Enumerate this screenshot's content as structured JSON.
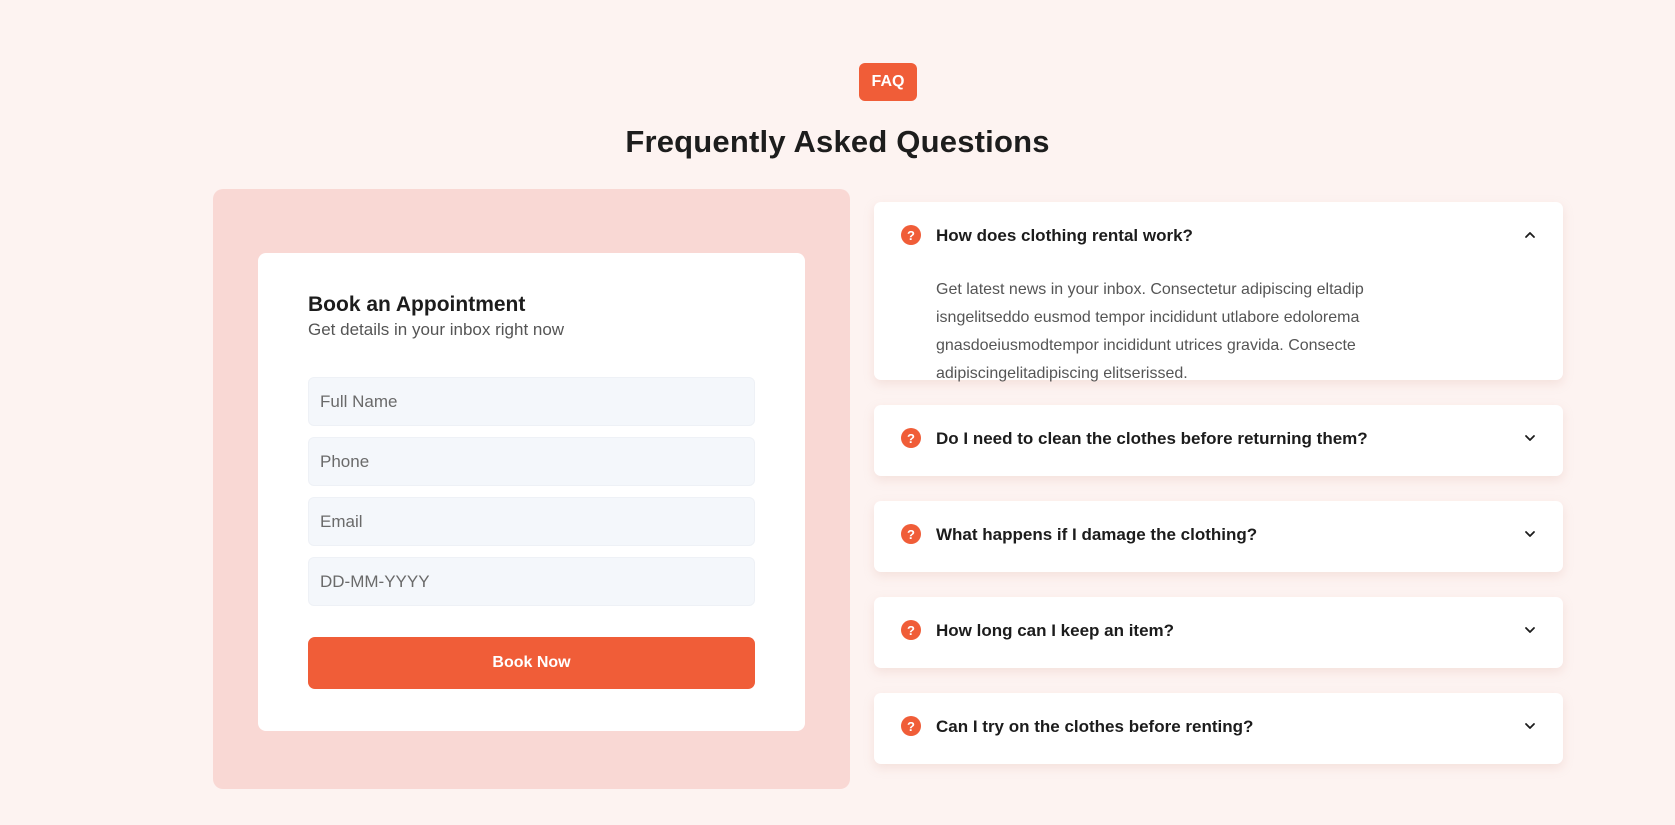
{
  "header": {
    "badge": "FAQ",
    "title": "Frequently Asked Questions"
  },
  "booking": {
    "title": "Book an Appointment",
    "subtitle": "Get details in your inbox right now",
    "fields": {
      "name_placeholder": "Full Name",
      "phone_placeholder": "Phone",
      "email_placeholder": "Email",
      "date_placeholder": "DD-MM-YYYY"
    },
    "button_label": "Book Now"
  },
  "faq": {
    "icon_glyph": "?",
    "items": [
      {
        "question": "How does clothing rental work?",
        "answer": "Get latest news in your inbox. Consectetur adipiscing eltadip isngelitseddo eusmod tempor incididunt utlabore edolorema gnasdoeiusmodtempor incididunt utrices gravida. Consecte adipiscingelitadipiscing elitserissed.",
        "expanded": true
      },
      {
        "question": "Do I need to clean the clothes before returning them?",
        "expanded": false
      },
      {
        "question": "What happens if I damage the clothing?",
        "expanded": false
      },
      {
        "question": "How long can I keep an item?",
        "expanded": false
      },
      {
        "question": "Can I try on the clothes before renting?",
        "expanded": false
      }
    ]
  },
  "colors": {
    "accent": "#f05d38",
    "page_bg": "#fdf3f1",
    "panel_bg": "#f9d8d4",
    "input_bg": "#f4f7fb"
  },
  "icons": {
    "faq_item": "question-circle-icon",
    "expanded": "chevron-up-icon",
    "collapsed": "chevron-down-icon"
  }
}
